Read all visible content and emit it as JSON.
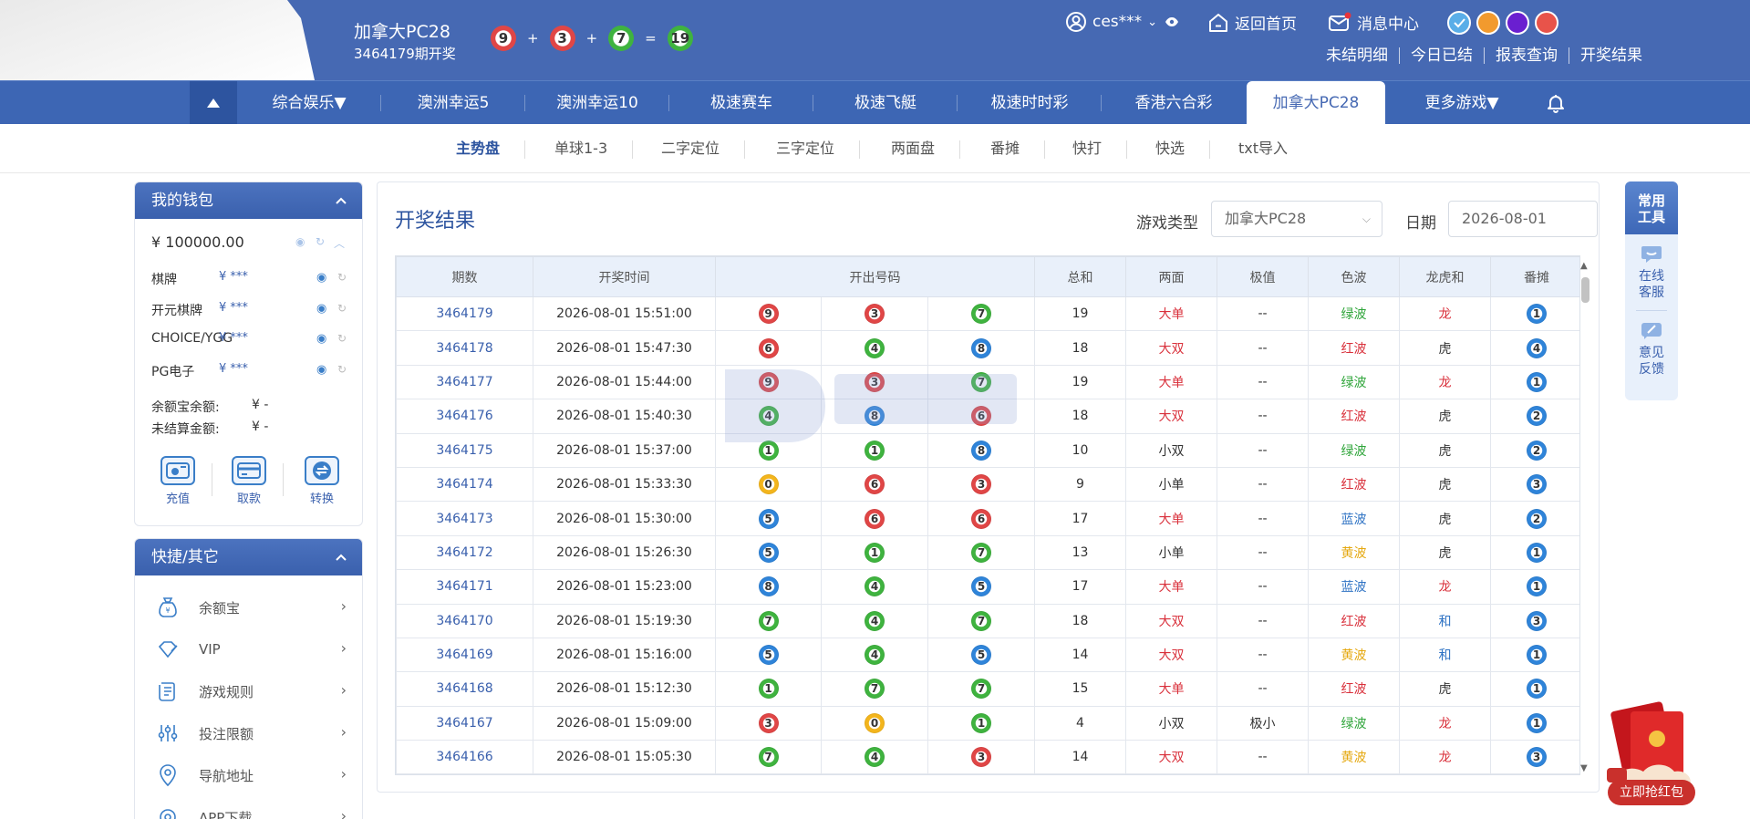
{
  "header": {
    "game_title": "加拿大PC28",
    "issue_line": "3464179期开奖",
    "last_draw": [
      {
        "n": "9",
        "c": "red"
      },
      {
        "n": "3",
        "c": "red"
      },
      {
        "n": "7",
        "c": "green"
      }
    ],
    "sum": {
      "n": "19",
      "c": "green"
    },
    "plus": "+",
    "equals": "=",
    "user": "ces***",
    "home": "返回首页",
    "messages": "消息中心",
    "theme_colors": [
      "#5aaee8",
      "#f29a2e",
      "#6a1fd0",
      "#e8534a"
    ],
    "links": [
      "未结明细",
      "今日已结",
      "报表查询",
      "开奖结果"
    ]
  },
  "nav": {
    "items": [
      "综合娱乐▼",
      "澳洲幸运5",
      "澳洲幸运10",
      "极速赛车",
      "极速飞艇",
      "极速时时彩",
      "香港六合彩",
      "加拿大PC28",
      "更多游戏▼"
    ],
    "active": "加拿大PC28"
  },
  "subnav": [
    "主势盘",
    "单球1-3",
    "二字定位",
    "三字定位",
    "两面盘",
    "番摊",
    "快打",
    "快选",
    "txt导入"
  ],
  "wallet": {
    "title": "我的钱包",
    "total": "¥ 100000.00",
    "rows": [
      {
        "label": "棋牌",
        "amount": "¥ ***"
      },
      {
        "label": "开元棋牌",
        "amount": "¥ ***"
      },
      {
        "label": "CHOICE/YGG",
        "amount": "¥ ***"
      },
      {
        "label": "PG电子",
        "amount": "¥ ***"
      }
    ],
    "yuebao_label": "余额宝余额:",
    "yuebao_value": "¥ -",
    "unsettled_label": "未结算金额:",
    "unsettled_value": "¥ -",
    "buttons": [
      "充值",
      "取款",
      "转换"
    ]
  },
  "quick": {
    "title": "快捷/其它",
    "items": [
      "余额宝",
      "VIP",
      "游戏规则",
      "投注限额",
      "导航地址",
      "APP下载"
    ]
  },
  "results": {
    "title": "开奖结果",
    "game_type_label": "游戏类型",
    "game_type_value": "加拿大PC28",
    "date_label": "日期",
    "date_value": "2026-08-01",
    "columns": [
      "期数",
      "开奖时间",
      "开出号码",
      "总和",
      "两面",
      "极值",
      "色波",
      "龙虎和",
      "番摊"
    ],
    "rows": [
      {
        "issue": "3464179",
        "time": "2026-08-01 15:51:00",
        "balls": [
          {
            "n": "9",
            "c": "red"
          },
          {
            "n": "3",
            "c": "red"
          },
          {
            "n": "7",
            "c": "green"
          }
        ],
        "sum": "19",
        "lm": "大单",
        "lmc": "red",
        "jz": "--",
        "sb": "绿波",
        "sbc": "green",
        "lh": "龙",
        "lhc": "red",
        "ft": "1"
      },
      {
        "issue": "3464178",
        "time": "2026-08-01 15:47:30",
        "balls": [
          {
            "n": "6",
            "c": "red"
          },
          {
            "n": "4",
            "c": "green"
          },
          {
            "n": "8",
            "c": "blue"
          }
        ],
        "sum": "18",
        "lm": "大双",
        "lmc": "red",
        "jz": "--",
        "sb": "红波",
        "sbc": "red",
        "lh": "虎",
        "lhc": "dark",
        "ft": "4"
      },
      {
        "issue": "3464177",
        "time": "2026-08-01 15:44:00",
        "balls": [
          {
            "n": "9",
            "c": "red"
          },
          {
            "n": "3",
            "c": "red"
          },
          {
            "n": "7",
            "c": "green"
          }
        ],
        "sum": "19",
        "lm": "大单",
        "lmc": "red",
        "jz": "--",
        "sb": "绿波",
        "sbc": "green",
        "lh": "龙",
        "lhc": "red",
        "ft": "1"
      },
      {
        "issue": "3464176",
        "time": "2026-08-01 15:40:30",
        "balls": [
          {
            "n": "4",
            "c": "green"
          },
          {
            "n": "8",
            "c": "blue"
          },
          {
            "n": "6",
            "c": "red"
          }
        ],
        "sum": "18",
        "lm": "大双",
        "lmc": "red",
        "jz": "--",
        "sb": "红波",
        "sbc": "red",
        "lh": "虎",
        "lhc": "dark",
        "ft": "2"
      },
      {
        "issue": "3464175",
        "time": "2026-08-01 15:37:00",
        "balls": [
          {
            "n": "1",
            "c": "green"
          },
          {
            "n": "1",
            "c": "green"
          },
          {
            "n": "8",
            "c": "blue"
          }
        ],
        "sum": "10",
        "lm": "小双",
        "lmc": "dark",
        "jz": "--",
        "sb": "绿波",
        "sbc": "green",
        "lh": "虎",
        "lhc": "dark",
        "ft": "2"
      },
      {
        "issue": "3464174",
        "time": "2026-08-01 15:33:30",
        "balls": [
          {
            "n": "0",
            "c": "yellow"
          },
          {
            "n": "6",
            "c": "red"
          },
          {
            "n": "3",
            "c": "red"
          }
        ],
        "sum": "9",
        "lm": "小单",
        "lmc": "dark",
        "jz": "--",
        "sb": "红波",
        "sbc": "red",
        "lh": "虎",
        "lhc": "dark",
        "ft": "3"
      },
      {
        "issue": "3464173",
        "time": "2026-08-01 15:30:00",
        "balls": [
          {
            "n": "5",
            "c": "blue"
          },
          {
            "n": "6",
            "c": "red"
          },
          {
            "n": "6",
            "c": "red"
          }
        ],
        "sum": "17",
        "lm": "大单",
        "lmc": "red",
        "jz": "--",
        "sb": "蓝波",
        "sbc": "blue",
        "lh": "虎",
        "lhc": "dark",
        "ft": "2"
      },
      {
        "issue": "3464172",
        "time": "2026-08-01 15:26:30",
        "balls": [
          {
            "n": "5",
            "c": "blue"
          },
          {
            "n": "1",
            "c": "green"
          },
          {
            "n": "7",
            "c": "green"
          }
        ],
        "sum": "13",
        "lm": "小单",
        "lmc": "dark",
        "jz": "--",
        "sb": "黄波",
        "sbc": "yellow",
        "lh": "虎",
        "lhc": "dark",
        "ft": "1"
      },
      {
        "issue": "3464171",
        "time": "2026-08-01 15:23:00",
        "balls": [
          {
            "n": "8",
            "c": "blue"
          },
          {
            "n": "4",
            "c": "green"
          },
          {
            "n": "5",
            "c": "blue"
          }
        ],
        "sum": "17",
        "lm": "大单",
        "lmc": "red",
        "jz": "--",
        "sb": "蓝波",
        "sbc": "blue",
        "lh": "龙",
        "lhc": "red",
        "ft": "1"
      },
      {
        "issue": "3464170",
        "time": "2026-08-01 15:19:30",
        "balls": [
          {
            "n": "7",
            "c": "green"
          },
          {
            "n": "4",
            "c": "green"
          },
          {
            "n": "7",
            "c": "green"
          }
        ],
        "sum": "18",
        "lm": "大双",
        "lmc": "red",
        "jz": "--",
        "sb": "红波",
        "sbc": "red",
        "lh": "和",
        "lhc": "blue",
        "ft": "3"
      },
      {
        "issue": "3464169",
        "time": "2026-08-01 15:16:00",
        "balls": [
          {
            "n": "5",
            "c": "blue"
          },
          {
            "n": "4",
            "c": "green"
          },
          {
            "n": "5",
            "c": "blue"
          }
        ],
        "sum": "14",
        "lm": "大双",
        "lmc": "red",
        "jz": "--",
        "sb": "黄波",
        "sbc": "yellow",
        "lh": "和",
        "lhc": "blue",
        "ft": "1"
      },
      {
        "issue": "3464168",
        "time": "2026-08-01 15:12:30",
        "balls": [
          {
            "n": "1",
            "c": "green"
          },
          {
            "n": "7",
            "c": "green"
          },
          {
            "n": "7",
            "c": "green"
          }
        ],
        "sum": "15",
        "lm": "大单",
        "lmc": "red",
        "jz": "--",
        "sb": "红波",
        "sbc": "red",
        "lh": "虎",
        "lhc": "dark",
        "ft": "1"
      },
      {
        "issue": "3464167",
        "time": "2026-08-01 15:09:00",
        "balls": [
          {
            "n": "3",
            "c": "red"
          },
          {
            "n": "0",
            "c": "yellow"
          },
          {
            "n": "1",
            "c": "green"
          }
        ],
        "sum": "4",
        "lm": "小双",
        "lmc": "dark",
        "jz": "极小",
        "sb": "绿波",
        "sbc": "green",
        "lh": "龙",
        "lhc": "red",
        "ft": "1"
      },
      {
        "issue": "3464166",
        "time": "2026-08-01 15:05:30",
        "balls": [
          {
            "n": "7",
            "c": "green"
          },
          {
            "n": "4",
            "c": "green"
          },
          {
            "n": "3",
            "c": "red"
          }
        ],
        "sum": "14",
        "lm": "大双",
        "lmc": "red",
        "jz": "--",
        "sb": "黄波",
        "sbc": "yellow",
        "lh": "龙",
        "lhc": "red",
        "ft": "3"
      }
    ]
  },
  "tools": {
    "title_line1": "常用",
    "title_line2": "工具",
    "service_line1": "在线",
    "service_line2": "客服",
    "feedback_line1": "意见",
    "feedback_line2": "反馈"
  },
  "redpacket": "立即抢红包",
  "icons": [
    "user-icon",
    "eye-icon",
    "home-icon",
    "mail-icon",
    "bell-icon",
    "chevron-up-icon",
    "refresh-icon",
    "recharge-icon",
    "withdraw-icon",
    "transfer-icon",
    "yuebao-icon",
    "vip-icon",
    "rules-icon",
    "limits-icon",
    "location-icon",
    "app-icon",
    "service-icon",
    "feedback-icon",
    "red-packet-icon"
  ]
}
